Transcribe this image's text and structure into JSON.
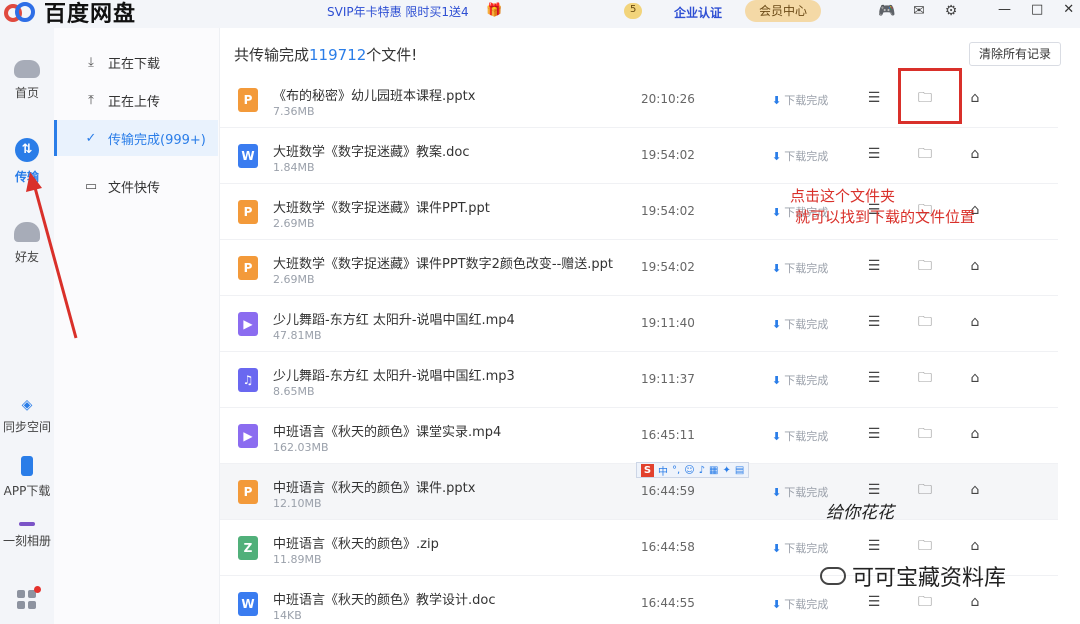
{
  "app": {
    "logo_text": "百度网盘",
    "promo": "SVIP年卡特惠 限时买1送4",
    "coin_label": "5",
    "enterprise": "企业认证",
    "vip_center": "会员中心"
  },
  "top_icons": [
    "game-icon",
    "mail-icon",
    "settings-icon"
  ],
  "window_controls": {
    "minimize": "—",
    "maximize": "□",
    "close": "✕"
  },
  "leftnav": {
    "home": "首页",
    "transfer": "传输",
    "friends": "好友",
    "sync": "同步空间",
    "app_download": "APP下载",
    "album": "一刻相册"
  },
  "subnav": {
    "downloading": "正在下载",
    "uploading": "正在上传",
    "completed": "传输完成(999+)",
    "quick_send": "文件快传"
  },
  "summary": {
    "prefix": "共传输完成",
    "count": "119712",
    "suffix": "个文件!"
  },
  "clear_button": "清除所有记录",
  "status_label": "下载完成",
  "files": [
    {
      "name": "《布的秘密》幼儿园班本课程.pptx",
      "size": "7.36MB",
      "time": "20:10:26",
      "type": "ppt",
      "glyph": "P"
    },
    {
      "name": "大班数学《数字捉迷藏》教案.doc",
      "size": "1.84MB",
      "time": "19:54:02",
      "type": "doc",
      "glyph": "W"
    },
    {
      "name": "大班数学《数字捉迷藏》课件PPT.ppt",
      "size": "2.69MB",
      "time": "19:54:02",
      "type": "ppt",
      "glyph": "P"
    },
    {
      "name": "大班数学《数字捉迷藏》课件PPT数字2颜色改变--赠送.ppt",
      "size": "2.69MB",
      "time": "19:54:02",
      "type": "ppt",
      "glyph": "P"
    },
    {
      "name": "少儿舞蹈-东方红 太阳升-说唱中国红.mp4",
      "size": "47.81MB",
      "time": "19:11:40",
      "type": "video",
      "glyph": "▶"
    },
    {
      "name": "少儿舞蹈-东方红 太阳升-说唱中国红.mp3",
      "size": "8.65MB",
      "time": "19:11:37",
      "type": "audio",
      "glyph": "♫"
    },
    {
      "name": "中班语言《秋天的颜色》课堂实录.mp4",
      "size": "162.03MB",
      "time": "16:45:11",
      "type": "video",
      "glyph": "▶"
    },
    {
      "name": "中班语言《秋天的颜色》课件.pptx",
      "size": "12.10MB",
      "time": "16:44:59",
      "type": "ppt",
      "glyph": "P"
    },
    {
      "name": "中班语言《秋天的颜色》.zip",
      "size": "11.89MB",
      "time": "16:44:58",
      "type": "zip",
      "glyph": "Z"
    },
    {
      "name": "中班语言《秋天的颜色》教学设计.doc",
      "size": "14KB",
      "time": "16:44:55",
      "type": "doc",
      "glyph": "W"
    }
  ],
  "annotation": {
    "line1": "点击这个文件夹",
    "line2": "就可以找到下载的文件位置"
  },
  "ime": {
    "brand": "S",
    "mode": "中"
  },
  "sticker_text": "给你花花",
  "watermark": "可可宝藏资料库",
  "colors": {
    "accent": "#2a7de8",
    "annotation": "#d9302a"
  }
}
